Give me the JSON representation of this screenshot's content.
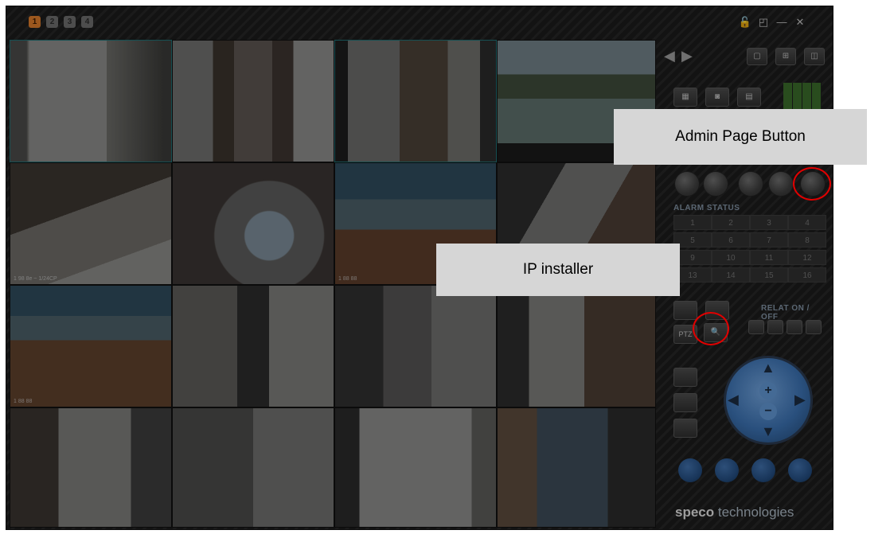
{
  "pages": [
    "1",
    "2",
    "3",
    "4"
  ],
  "window_controls": {
    "lock": "🔓",
    "restore": "◰",
    "minimize": "—",
    "close": "✕"
  },
  "panel": {
    "alarm_status_label": "ALARM STATUS",
    "alarm_numbers": [
      "1",
      "2",
      "3",
      "4",
      "5",
      "6",
      "7",
      "8",
      "9",
      "10",
      "11",
      "12",
      "13",
      "14",
      "15",
      "16"
    ],
    "relay_label": "RELAT ON / OFF",
    "brand_bold": "speco",
    "brand_light": " technologies"
  },
  "callouts": {
    "admin_page_button": "Admin Page Button",
    "ip_installer": "IP installer"
  },
  "osd": [
    "1 98 8e ~ 1/24CP",
    "1 88 88",
    "1 88 88"
  ]
}
